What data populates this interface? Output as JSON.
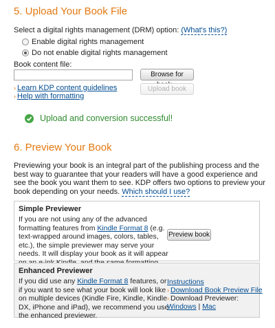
{
  "upload_section": {
    "heading": "5. Upload Your Book File",
    "drm_prompt": "Select a digital rights management (DRM) option:",
    "drm_help_link": "(What's this?)",
    "drm_options": [
      {
        "label": "Enable digital rights management",
        "selected": false
      },
      {
        "label": "Do not enable digital rights management",
        "selected": true
      }
    ],
    "file_label": "Book content file:",
    "file_value": "",
    "browse_button": "Browse for book...",
    "upload_button": "Upload book",
    "links": [
      "Learn KDP content guidelines",
      "Help with formatting"
    ],
    "success_message": "Upload and conversion successful!"
  },
  "preview_section": {
    "heading": "6. Preview Your Book",
    "intro": "Previewing your book is an integral part of the publishing process and the best way to guarantee that your readers will have a good experience and see the book you want them to see. KDP offers two options to preview your book depending on your needs.",
    "which_link": "Which should I use?",
    "simple": {
      "title": "Simple Previewer",
      "text_a": "If you are not using any of the advanced formatting features from ",
      "kf8_link": "Kindle Format 8",
      "text_b": " (e.g. text-wrapped around images, colors, tables, etc.), the simple previewer may serve your needs. It will display your book as it will appear on an e-ink Kindle, and the same formatting will appear on other devices.",
      "button": "Preview book"
    },
    "enhanced": {
      "title": "Enhanced Previewer",
      "text_a": "If you did use any ",
      "kf8_link": "Kindle Format 8",
      "text_b": " features, or if you want to see what your book will look like on multiple devices (Kindle Fire, Kindle, Kindle DX, iPhone and iPad), we recommend you use the enhanced previewer.",
      "instructions_link": "Instructions",
      "download_file_link": "Download Book Preview File",
      "download_previewer_label": "Download Previewer:",
      "windows_link": "Windows",
      "separator": "|",
      "mac_link": "Mac"
    }
  },
  "colors": {
    "heading": "#e47911",
    "link": "#004b91",
    "success": "#2e8b2e"
  }
}
